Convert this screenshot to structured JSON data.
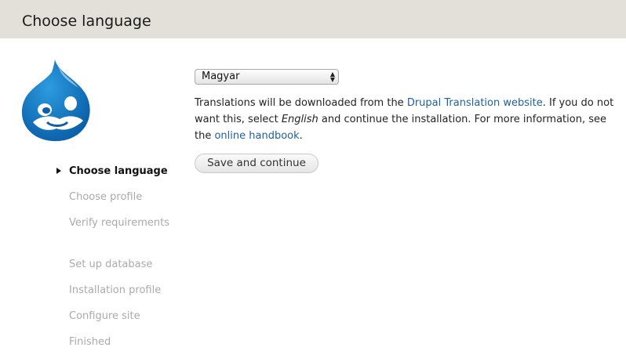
{
  "header": {
    "title": "Choose language"
  },
  "logo": {
    "icon": "drupal-drop-logo",
    "color": "#0077c0"
  },
  "steps": [
    {
      "label": "Choose language",
      "active": true
    },
    {
      "label": "Choose profile",
      "active": false
    },
    {
      "label": "Verify requirements",
      "active": false
    },
    {
      "label": "Set up database",
      "active": false
    },
    {
      "label": "Installation profile",
      "active": false
    },
    {
      "label": "Configure site",
      "active": false
    },
    {
      "label": "Finished",
      "active": false
    }
  ],
  "language_select": {
    "selected": "Magyar",
    "arrows": "▲▼"
  },
  "description": {
    "part1": "Translations will be downloaded from the ",
    "link1": "Drupal Translation website",
    "part2": ". If you do not want this, select ",
    "emph": "English",
    "part3": " and continue the installation. For more information, see the ",
    "link2": "online handbook",
    "part4": "."
  },
  "buttons": {
    "save_label": "Save and continue"
  },
  "colors": {
    "header_bg": "#e2e0d8",
    "link": "#1f5fa6",
    "inactive_step": "#aaaaaa"
  }
}
